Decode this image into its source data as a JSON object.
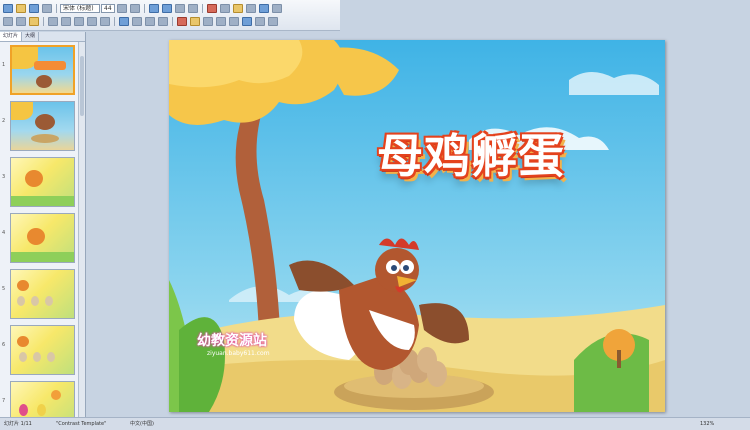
{
  "ribbon": {
    "font_name": "宋体 (标题)",
    "font_size": "44"
  },
  "panel": {
    "tabs": [
      "幻灯片",
      "大纲"
    ],
    "thumb_numbers": [
      "1",
      "2",
      "3",
      "4",
      "5",
      "6",
      "7"
    ]
  },
  "slide": {
    "title": "母鸡孵蛋",
    "watermark": "幼教资源站",
    "watermark_url": "ziyuan.baby611.com"
  },
  "status": {
    "slide_info": "幻灯片 1/11",
    "theme": "\"Contrast Template\"",
    "language": "中文(中国)",
    "zoom": "132%"
  },
  "colors": {
    "sky": "#59bfe6",
    "title_outline": "#e4421d",
    "selected_border": "#f0a227"
  }
}
